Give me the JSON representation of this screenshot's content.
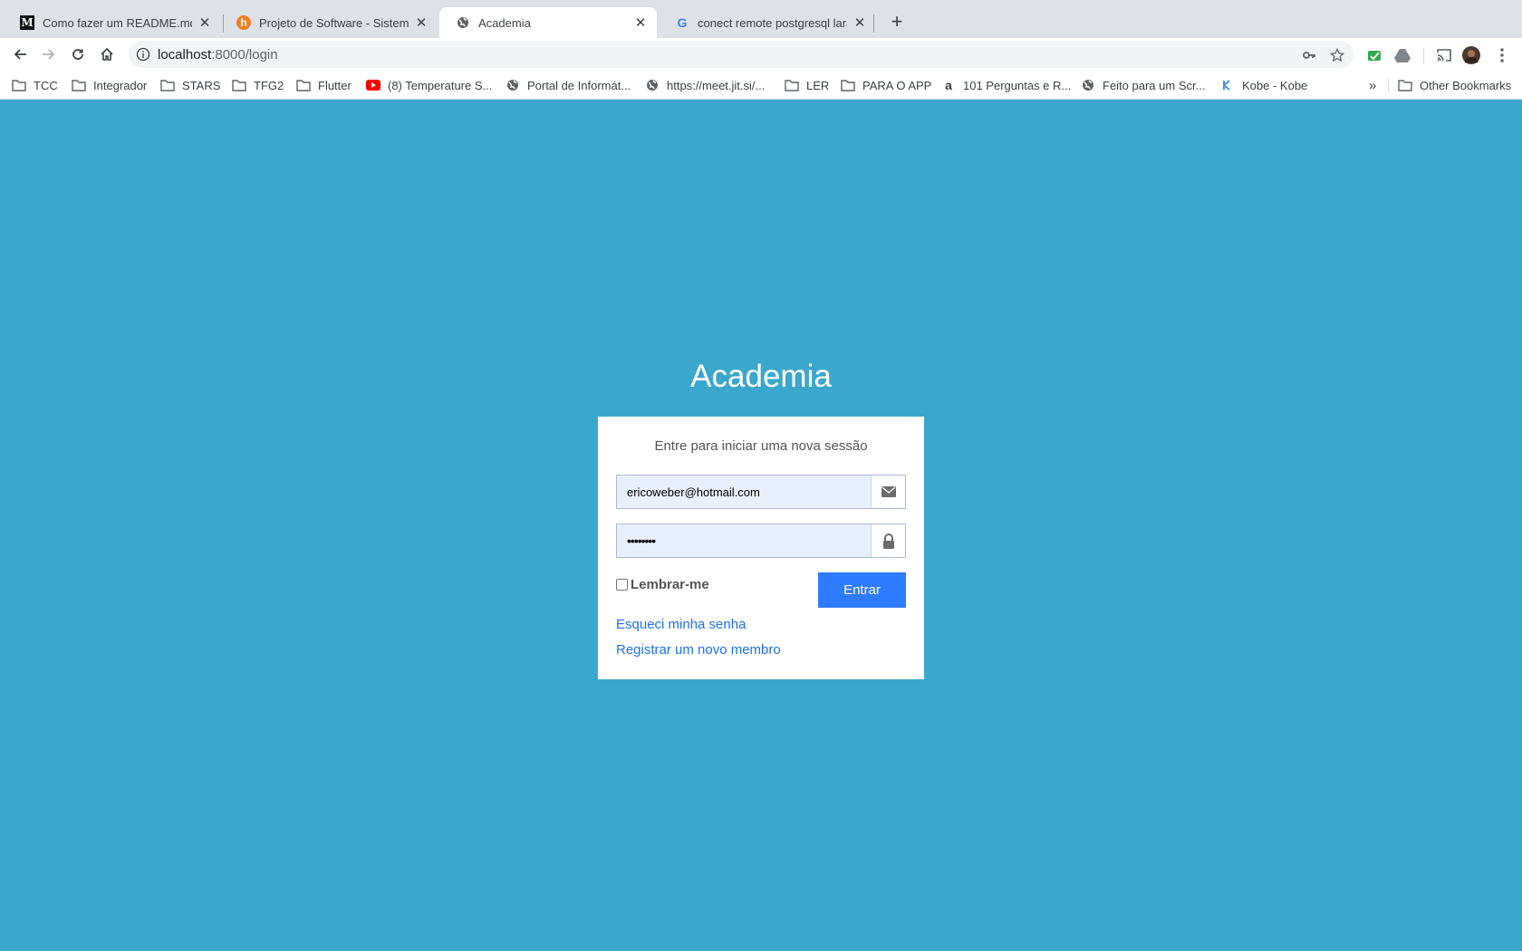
{
  "browser": {
    "tabs": [
      {
        "title": "Como fazer um README.md Bi",
        "favicon": "M"
      },
      {
        "title": "Projeto de Software - Sistema",
        "favicon": "h"
      },
      {
        "title": "Academia",
        "favicon": "globe-icon"
      },
      {
        "title": "conect remote postgresql larav",
        "favicon": "G"
      }
    ],
    "url": {
      "host": "localhost",
      "path": ":8000/login"
    },
    "bookmarks": [
      {
        "label": "TCC",
        "icon": "folder-icon"
      },
      {
        "label": "Integrador",
        "icon": "folder-icon"
      },
      {
        "label": "STARS",
        "icon": "folder-icon"
      },
      {
        "label": "TFG2",
        "icon": "folder-icon"
      },
      {
        "label": "Flutter",
        "icon": "folder-icon"
      },
      {
        "label": "(8) Temperature S...",
        "icon": "youtube-icon"
      },
      {
        "label": "Portal de Informát...",
        "icon": "globe-icon"
      },
      {
        "label": "https://meet.jit.si/...",
        "icon": "globe-icon"
      },
      {
        "label": "LER",
        "icon": "folder-icon"
      },
      {
        "label": "PARA O APP",
        "icon": "folder-icon"
      },
      {
        "label": "101 Perguntas e R...",
        "icon": "amazon-icon"
      },
      {
        "label": "Feito para um Scr...",
        "icon": "globe-icon"
      },
      {
        "label": "Kobe - Kobe",
        "icon": "kobe-icon"
      }
    ],
    "other_bookmarks": "Other Bookmarks",
    "overflow": "»"
  },
  "page": {
    "brand": "Academia",
    "login_message": "Entre para iniciar uma nova sessão",
    "email_value": "ericoweber@hotmail.com",
    "password_value": "••••••••",
    "remember_label": "Lembrar-me",
    "submit_label": "Entrar",
    "forgot_link": "Esqueci minha senha",
    "register_link": "Registrar um novo membro"
  },
  "colors": {
    "background": "#3ba7cc",
    "button": "#2f7bff",
    "link": "#1e6ff5"
  }
}
